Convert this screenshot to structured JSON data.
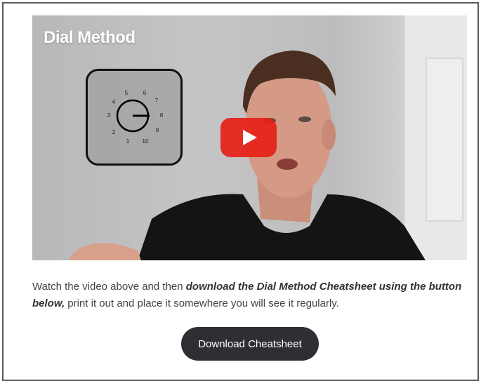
{
  "video": {
    "title": "Dial Method",
    "dial_numbers": [
      "1",
      "2",
      "3",
      "4",
      "5",
      "6",
      "7",
      "8",
      "9",
      "10"
    ]
  },
  "description": {
    "intro": "Watch the video above and then ",
    "emphasis": "download the Dial Method Cheatsheet using the button below,",
    "outro": " print it out and place it somewhere you will see it regularly."
  },
  "download_button": {
    "label": "Download Cheatsheet"
  },
  "colors": {
    "play_red": "#e62117",
    "button_dark": "#2d2f32"
  }
}
